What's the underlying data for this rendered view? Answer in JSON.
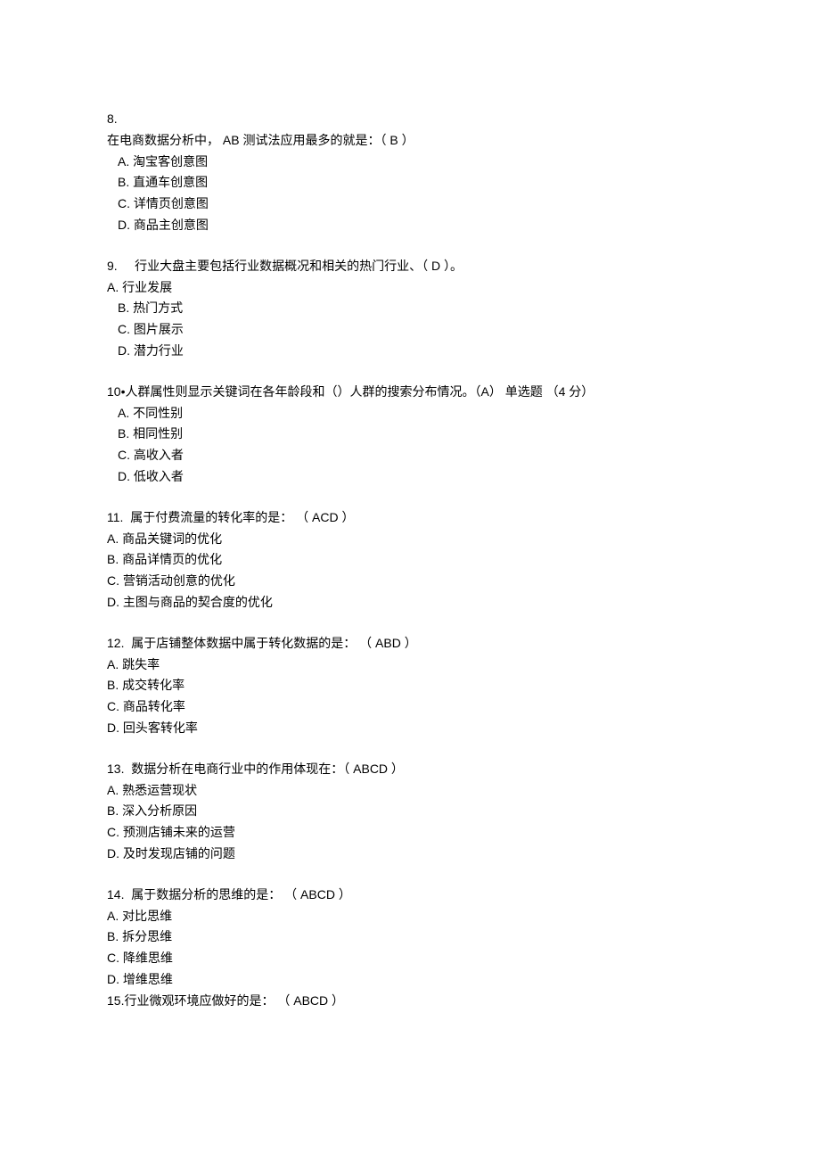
{
  "questions": [
    {
      "num": "8.",
      "stem": "在电商数据分析中，  AB 测试法应用最多的就是：（  B ）",
      "opts": [
        "A.   淘宝客创意图",
        "B.   直通车创意图",
        "C.   详情页创意图",
        "D.   商品主创意图"
      ]
    },
    {
      "num": "9.",
      "stem": "行业大盘主要包括行业数据概况和相关的热门行业、（  D ）。",
      "opts": [
        "A.        行业发展",
        "B.   热门方式",
        "C.   图片展示",
        "D.   潜力行业"
      ]
    },
    {
      "num": "10•",
      "stem": "人群属性则显示关键词在各年龄段和（）人群的搜索分布情况。（A）  单选题   （4 分）",
      "opts": [
        "A.   不同性别",
        "B.   相同性别",
        "C.   高收入者",
        "D.   低收入者"
      ]
    },
    {
      "num": "11.",
      "stem": "属于付费流量的转化率的是： （  ACD ）",
      "opts": [
        "A.   商品关键词的优化",
        "B.   商品详情页的优化",
        "C.   营销活动创意的优化",
        "D.   主图与商品的契合度的优化"
      ]
    },
    {
      "num": "12.",
      "stem": "属于店铺整体数据中属于转化数据的是： （  ABD ）",
      "opts": [
        "A.   跳失率",
        "B.   成交转化率",
        "C.   商品转化率",
        "D.   回头客转化率"
      ]
    },
    {
      "num": "13.",
      "stem": "数据分析在电商行业中的作用体现在：（  ABCD ）",
      "opts": [
        "A.   熟悉运营现状",
        "B.   深入分析原因",
        "C.   预测店铺未来的运营",
        "D.   及时发现店铺的问题"
      ]
    },
    {
      "num": "14.",
      "stem": "属于数据分析的思维的是： （  ABCD ）",
      "opts": [
        "A.   对比思维",
        "B.   拆分思维",
        "C.   降维思维",
        "D.   增维思维"
      ]
    },
    {
      "num": "15.",
      "stem": "行业微观环境应做好的是： （  ABCD ）",
      "opts": []
    }
  ]
}
